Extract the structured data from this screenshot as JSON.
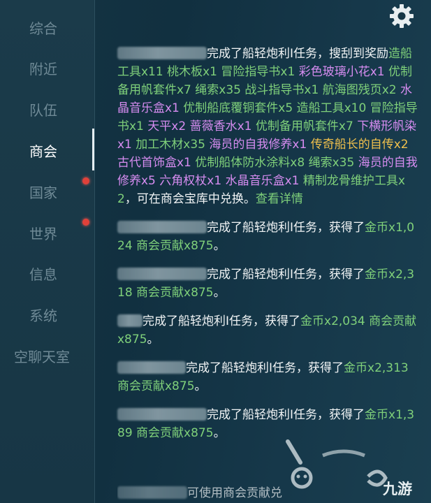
{
  "sidebar": {
    "tabs": [
      {
        "label": "综合"
      },
      {
        "label": "附近"
      },
      {
        "label": "队伍"
      },
      {
        "label": "商会"
      },
      {
        "label": "国家"
      },
      {
        "label": "世界"
      },
      {
        "label": "信息"
      },
      {
        "label": "系统"
      },
      {
        "label": "空聊天室"
      }
    ],
    "active_tab": "商会"
  },
  "colors": {
    "item_green": "#7fd07a",
    "item_purple": "#d68cf0",
    "item_orange": "#f0c04c",
    "badge_red": "#e0413a"
  },
  "feed": {
    "msg1": {
      "text_a": "完成了船轻炮利I任务，搜刮到奖励",
      "s1": "造船工具x11",
      "s2": "桃木板x1",
      "s3": "冒险指导书x1",
      "s4": "彩色玻璃小花x1",
      "s5": "优制备用帆套件x7",
      "s6": "绳索x35",
      "s7": "战斗指导书x1",
      "s8": "航海图残页x2",
      "s9": "水晶音乐盒x1",
      "s10": "优制船底覆铜套件x5",
      "s11": "造船工具x10",
      "s12": "冒险指导书x1",
      "s13": "天平x2",
      "s14": "蔷薇香水x1",
      "s15": "优制备用帆套件x7",
      "s16": "下横形帆染x1",
      "s17": "加工木材x35",
      "s18": "海员的自我修养x1",
      "s19": "传奇船长的自传x2",
      "s20": "古代首饰盒x1",
      "s21": "优制船体防水涂料x8",
      "s22": "绳索x35",
      "s23": "海员的自我修养x5",
      "s24": "六角权杖x1",
      "s25": "水晶音乐盒x1",
      "s26": "精制龙骨维护工具x2",
      "text_b": "，可在商会宝库中兑换。",
      "link": "查看详情"
    },
    "msg2": {
      "text": "完成了船轻炮利I任务，获得了",
      "gold": "金币x1,024",
      "contrib": "商会贡献x875",
      "end": "。"
    },
    "msg3": {
      "text": "完成了船轻炮利I任务，获得了",
      "gold": "金币x2,318",
      "contrib": "商会贡献x875",
      "end": "。"
    },
    "msg4": {
      "text": "完成了船轻炮利I任务，获得了",
      "gold": "金币x2,034",
      "contrib": "商会贡献x875",
      "end": "。"
    },
    "msg5": {
      "text": "完成了船轻炮利I任务，获得了",
      "gold": "金币x2,313",
      "contrib": "商会贡献x875",
      "end": "。"
    },
    "msg6": {
      "text": "完成了船轻炮利I任务，获得了",
      "gold": "金币x1,389",
      "contrib": "商会贡献x875",
      "end": "。"
    },
    "partial_text": "可使用商会贡献兑"
  },
  "watermark": {
    "text": "九游"
  }
}
